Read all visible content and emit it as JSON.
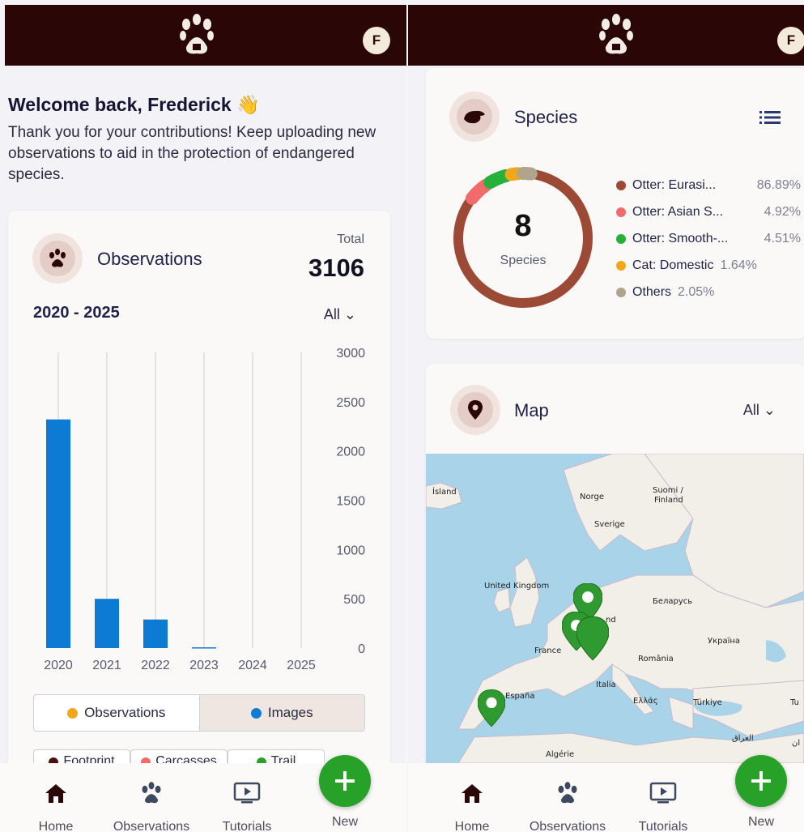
{
  "app": {
    "colors": {
      "topbar": "#2a0606",
      "accent_blue": "#0d7ad3",
      "fab_green": "#27a127",
      "chart_blue": "#0d7ad3"
    },
    "avatar_initial": "F",
    "logo_icon": "paw-logo-icon"
  },
  "welcome": {
    "title": "Welcome back, Frederick 👋",
    "message": "Thank you for your contributions! Keep uploading new observations to aid in the protection of endangered species."
  },
  "observations_card": {
    "title": "Observations",
    "total_label": "Total",
    "total_value": "3106",
    "range": "2020 - 2025",
    "filter": "All ⌄",
    "toggle": {
      "left": "Observations",
      "right": "Images",
      "left_dot": "#f0a81a",
      "right_dot": "#0d7ad3"
    },
    "categories": [
      "Footprint",
      "Carcasses",
      "Trail"
    ],
    "category_dots": [
      "#4a1010",
      "#f26b6b",
      "#27a127"
    ]
  },
  "chart_data": {
    "type": "bar",
    "categories": [
      "2020",
      "2021",
      "2022",
      "2023",
      "2024",
      "2025"
    ],
    "series": [
      {
        "name": "Images",
        "values": [
          2320,
          500,
          290,
          8,
          0,
          0
        ]
      }
    ],
    "y_ticks": [
      "3000",
      "2500",
      "2000",
      "1500",
      "1000",
      "500",
      "0"
    ],
    "ylim": [
      0,
      3000
    ],
    "grid": "vertical lines per category",
    "y_axis_side": "right"
  },
  "species_card": {
    "title": "Species",
    "count": "8",
    "count_label": "Species",
    "legend": [
      {
        "name": "Otter: Eurasi...",
        "pct": "86.89%",
        "color": "#9c4a36",
        "value": 86.89
      },
      {
        "name": "Otter: Asian S...",
        "pct": "4.92%",
        "color": "#f26b6b",
        "value": 4.92
      },
      {
        "name": "Otter: Smooth-...",
        "pct": "4.51%",
        "color": "#27b03a",
        "value": 4.51
      },
      {
        "name": "Cat: Domestic",
        "pct": "1.64%",
        "color": "#f0a81a",
        "value": 1.64
      },
      {
        "name": "Others",
        "pct": "2.05%",
        "color": "#b0a48e",
        "value": 2.05
      }
    ]
  },
  "map_card": {
    "title": "Map",
    "filter": "All ⌄",
    "labels": [
      {
        "text": "Ísland"
      },
      {
        "text": "Norge"
      },
      {
        "text": "Suomi /"
      },
      {
        "text": "Finland"
      },
      {
        "text": "Sverige"
      },
      {
        "text": "United Kingdom"
      },
      {
        "text": "Беларусь"
      },
      {
        "text": "nd"
      },
      {
        "text": "France"
      },
      {
        "text": "Україна"
      },
      {
        "text": "România"
      },
      {
        "text": "España"
      },
      {
        "text": "Italia"
      },
      {
        "text": "Ελλάς"
      },
      {
        "text": "Türkiye"
      },
      {
        "text": "Tu"
      },
      {
        "text": "العراق"
      },
      {
        "text": "Algérie"
      },
      {
        "text": "ان"
      }
    ]
  },
  "nav": {
    "home": "Home",
    "observations": "Observations",
    "tutorials": "Tutorials",
    "new": "New"
  }
}
